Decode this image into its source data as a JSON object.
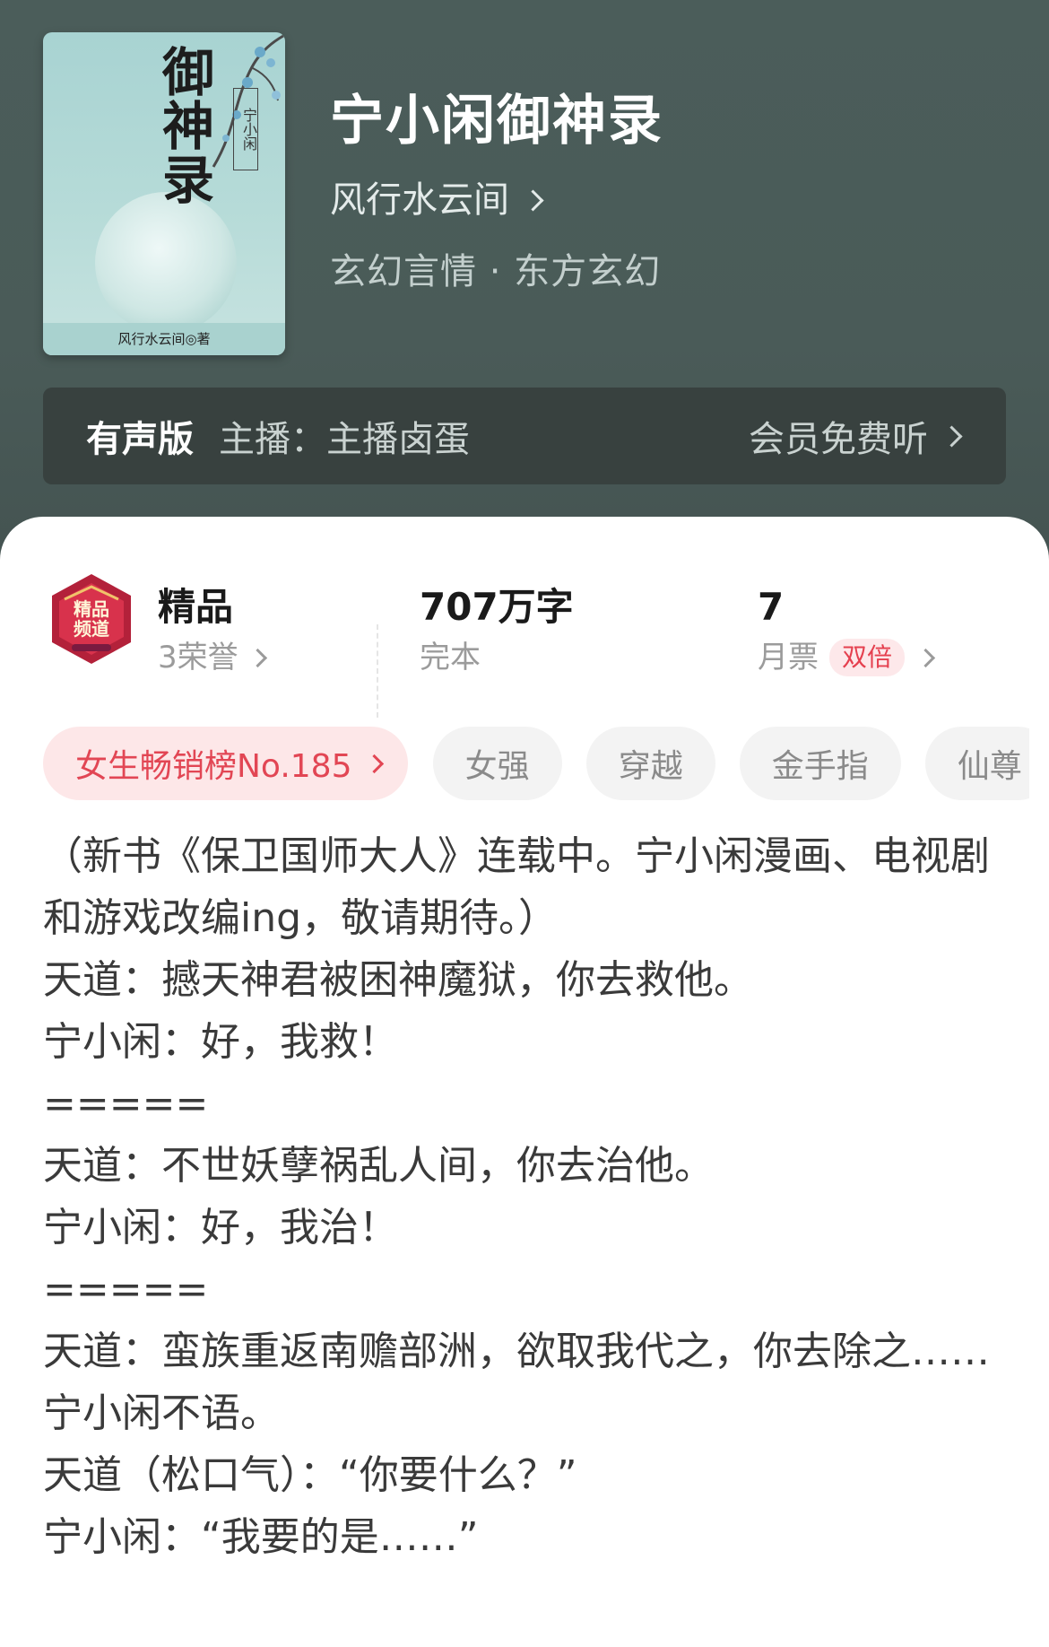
{
  "book": {
    "title": "宁小闲御神录",
    "author": "风行水云间",
    "genre": "玄幻言情 · 东方玄幻",
    "cover": {
      "title": "御神录",
      "subtitle": "宁小闲",
      "author_line": "风行水云间◎著"
    }
  },
  "audio": {
    "tag": "有声版",
    "host": "主播：主播卤蛋",
    "action": "会员免费听"
  },
  "stats": {
    "quality": {
      "main": "精品",
      "sub": "3荣誉"
    },
    "words": {
      "main": "707万字",
      "sub": "完本"
    },
    "tickets": {
      "main": "7",
      "sub": "月票",
      "badge": "双倍"
    }
  },
  "tags": {
    "rank": "女生畅销榜No.185",
    "items": [
      "女强",
      "穿越",
      "金手指",
      "仙尊"
    ]
  },
  "description": "（新书《保卫国师大人》连载中。宁小闲漫画、电视剧和游戏改编ing，敬请期待。）\n天道：撼天神君被困神魔狱，你去救他。\n宁小闲：好，我救！\n=====\n天道：不世妖孽祸乱人间，你去治他。\n宁小闲：好，我治！\n=====\n天道：蛮族重返南赡部洲，欲取我代之，你去除之……\n宁小闲不语。\n天道（松口气）：“你要什么？”\n宁小闲：“我要的是……”",
  "colors": {
    "header_bg": "#4b5d5a",
    "audio_bar_bg": "#38413f",
    "accent_red": "#e24654",
    "rank_tag_bg": "#fde7e8"
  }
}
